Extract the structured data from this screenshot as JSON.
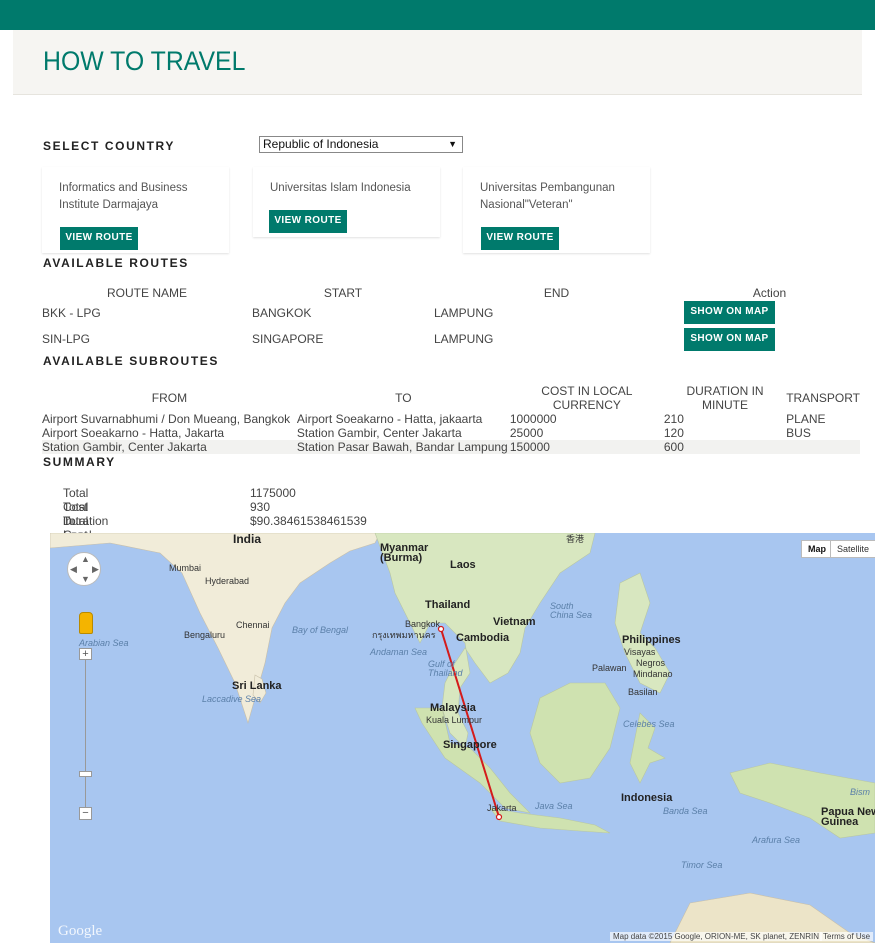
{
  "header": {
    "title": "HOW TO TRAVEL"
  },
  "country": {
    "label": "SELECT COUNTRY",
    "selected": "Republic of Indonesia"
  },
  "universities": [
    {
      "name": "Informatics and Business Institute Darmajaya",
      "button": "VIEW ROUTE"
    },
    {
      "name": "Universitas Islam Indonesia",
      "button": "VIEW ROUTE"
    },
    {
      "name": "Universitas Pembangunan Nasional\"Veteran\"",
      "button": "VIEW ROUTE"
    }
  ],
  "routes": {
    "title": "AVAILABLE ROUTES",
    "headers": [
      "ROUTE NAME",
      "START",
      "END",
      "Action"
    ],
    "rows": [
      {
        "name": "BKK - LPG",
        "start": "BANGKOK",
        "end": "LAMPUNG",
        "action": "SHOW ON MAP"
      },
      {
        "name": "SIN-LPG",
        "start": "SINGAPORE",
        "end": "LAMPUNG",
        "action": "SHOW ON MAP"
      }
    ]
  },
  "subroutes": {
    "title": "AVAILABLE SUBROUTES",
    "headers": [
      "FROM",
      "TO",
      "COST IN LOCAL CURRENCY",
      "DURATION IN MINUTE",
      "TRANSPORT"
    ],
    "rows": [
      {
        "from": "Airport Suvarnabhumi / Don Mueang, Bangkok",
        "to": "Airport Soeakarno - Hatta, jakaarta",
        "cost": "1000000",
        "duration": "210",
        "transport": "PLANE"
      },
      {
        "from": "Airport Soeakarno - Hatta, Jakarta",
        "to": "Station Gambir, Center Jakarta",
        "cost": "25000",
        "duration": "120",
        "transport": "BUS"
      },
      {
        "from": "Station Gambir, Center Jakarta",
        "to": "Station Pasar Bawah, Bandar Lampung",
        "cost": "150000",
        "duration": "600",
        "transport": ""
      }
    ]
  },
  "summary": {
    "title": "SUMMARY",
    "items": [
      {
        "label": "Total Cost in Local",
        "value": "1175000"
      },
      {
        "label": "Total Duration",
        "value": "930"
      },
      {
        "label": "Total Cost In USD",
        "value": "$90.38461538461539"
      }
    ]
  },
  "map": {
    "map_button": "Map",
    "satellite_button": "Satellite",
    "google": "Google",
    "attribution": "Map data ©2015 Google, ORION-ME, SK planet, ZENRIN",
    "terms": "Terms of Use",
    "labels": {
      "india": "India",
      "myanmar": "Myanmar\n(Burma)",
      "laos": "Laos",
      "thailand": "Thailand",
      "vietnam": "Vietnam",
      "cambodia": "Cambodia",
      "philippines": "Philippines",
      "malaysia": "Malaysia",
      "singapore": "Singapore",
      "indonesia": "Indonesia",
      "srilanka": "Sri Lanka",
      "papua": "Papua New\nGuinea",
      "mumbai": "Mumbai",
      "hyderabad": "Hyderabad",
      "chennai": "Chennai",
      "bengaluru": "Bengaluru",
      "bangkok": "Bangkok",
      "bangkok_thai": "กรุงเทพมหานคร",
      "kualalumpur": "Kuala Lumpur",
      "jakarta": "Jakarta",
      "visayas": "Visayas",
      "negros": "Negros",
      "mindanao": "Mindanao",
      "basilan": "Basilan",
      "palawan": "Palawan",
      "southchinasea": "South\nChina Sea",
      "bayofbengal": "Bay of Bengal",
      "arabiansea": "Arabian Sea",
      "andamansea": "Andaman Sea",
      "gulfthailand": "Gulf of\nThailand",
      "laccadive": "Laccadive Sea",
      "celebessea": "Celebes Sea",
      "javasea": "Java Sea",
      "bandasea": "Banda Sea",
      "arafurasea": "Arafura Sea",
      "timorsea": "Timor Sea",
      "bism": "Bism",
      "hongkong": "香港"
    }
  }
}
